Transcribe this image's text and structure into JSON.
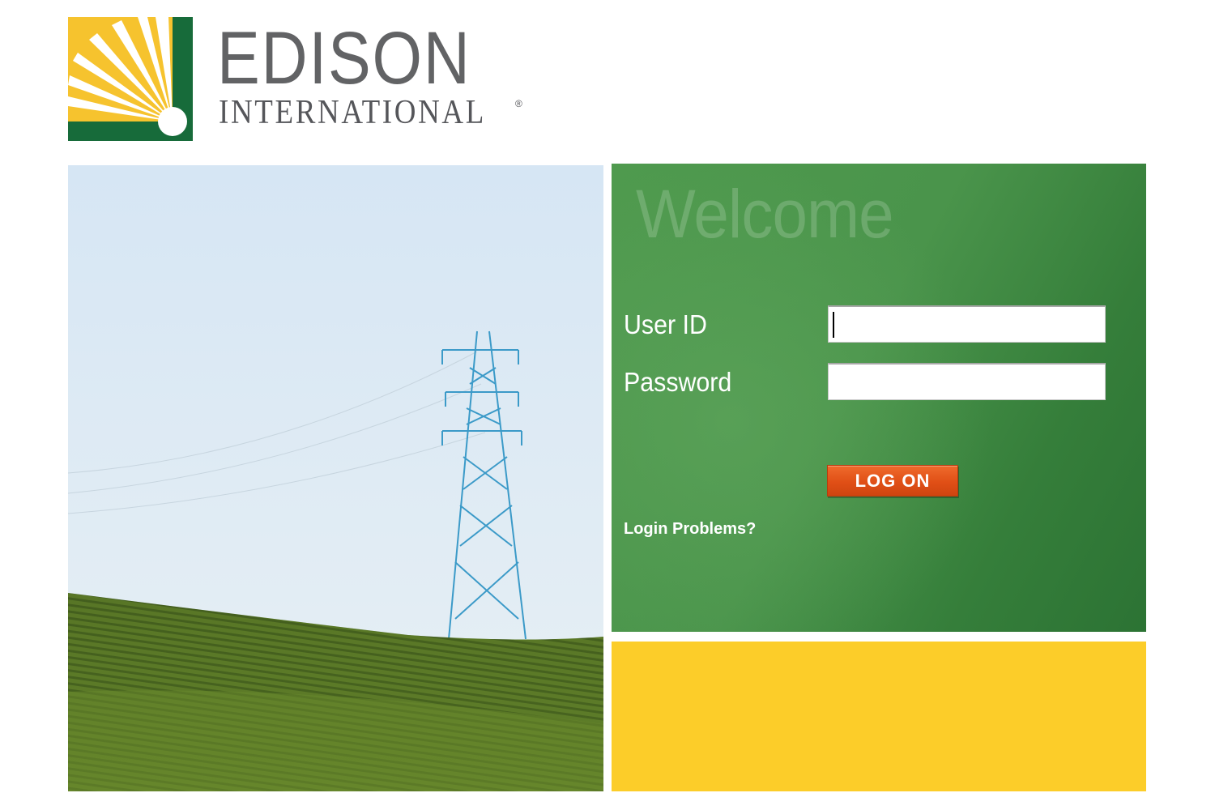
{
  "brand": {
    "name_line1": "EDISON",
    "name_line2": "INTERNATIONAL",
    "registered": "®",
    "logo_icon": "sunburst-logo-icon",
    "colors": {
      "green": "#176b3a",
      "yellow": "#f6c32e",
      "gray": "#626365"
    }
  },
  "photo": {
    "icon": "transmission-tower-photo"
  },
  "login": {
    "welcome": "Welcome",
    "user_id_label": "User ID",
    "user_id_value": "",
    "password_label": "Password",
    "password_value": "",
    "logon_button": "LOG ON",
    "problems_link": "Login Problems?",
    "colors": {
      "panel_green": "#4a944b",
      "button_orange": "#e04f16",
      "yellow_panel": "#fccd29"
    }
  }
}
